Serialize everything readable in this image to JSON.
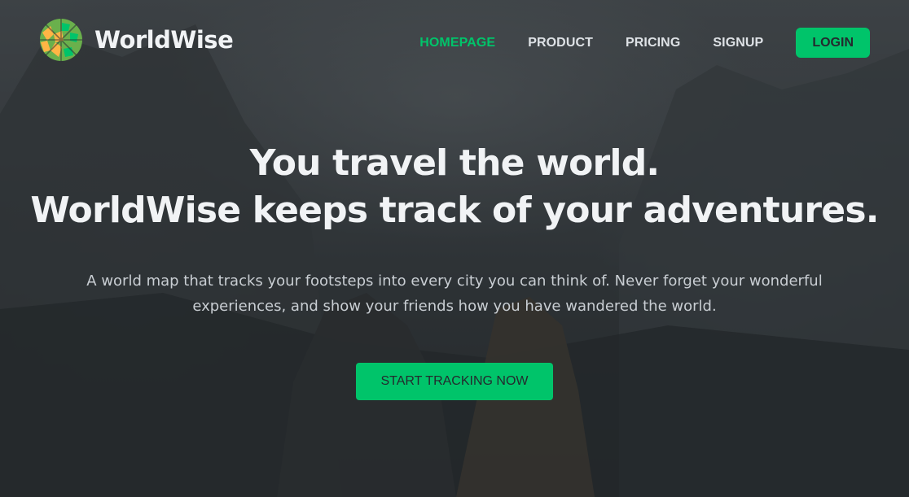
{
  "app": {
    "name": "WorldWise"
  },
  "nav": {
    "links": [
      {
        "label": "HOMEPAGE",
        "active": true
      },
      {
        "label": "PRODUCT",
        "active": false
      },
      {
        "label": "PRICING",
        "active": false
      },
      {
        "label": "SIGNUP",
        "active": false
      }
    ],
    "login_label": "LOGIN"
  },
  "hero": {
    "title_line1": "You travel the world.",
    "title_line2": "WorldWise keeps track of your adventures.",
    "description": "A world map that tracks your footsteps into every city you can think of. Never forget your wonderful experiences, and show your friends how you have wandered the world.",
    "cta_label": "START TRACKING NOW"
  },
  "colors": {
    "brand_green": "#00c46a",
    "brand_yellow": "#ffb545",
    "text_light": "#f1f3f5",
    "dark": "#242a2e"
  },
  "icons": {
    "logo": "globe-logo-icon"
  }
}
